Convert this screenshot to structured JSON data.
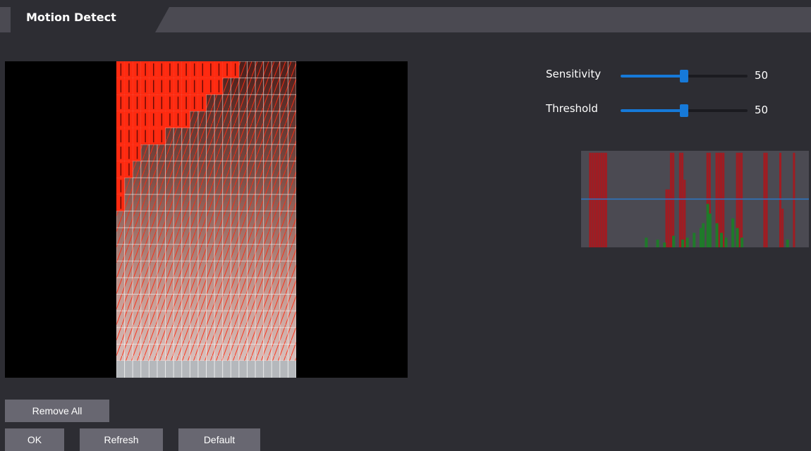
{
  "tab": {
    "title": "Motion Detect"
  },
  "settings": [
    {
      "label": "Sensitivity",
      "value": 50,
      "display": "50"
    },
    {
      "label": "Threshold",
      "value": 50,
      "display": "50"
    }
  ],
  "buttons": {
    "remove_all": "Remove All",
    "ok": "OK",
    "refresh": "Refresh",
    "default": "Default"
  },
  "colors": {
    "accent": "#1679d8",
    "grid_line": "#ff2a10",
    "detected_block": "#ff2a10",
    "graph_bar_red": "#a01c22",
    "graph_bar_green": "#1f7a2a",
    "graph_threshold_line": "#2a78c8",
    "button_bg": "#686771",
    "panel_bg": "#2d2d33"
  },
  "motion_graph": {
    "threshold_line": 0.5,
    "red_bars": [
      0.98,
      0.98,
      0.98,
      0.98,
      0.98,
      0.98,
      0.98,
      0.98,
      0.6,
      0.6,
      0.98,
      0.98,
      0.98,
      0.98,
      0.7,
      0.98,
      0.98,
      0.98,
      0.98,
      0.98,
      0.98,
      0.98,
      0.98,
      0.98,
      0.98,
      0.98,
      0.98,
      0.4,
      0.98
    ],
    "green_bars": [
      0.1,
      0.08,
      0.05,
      0.12,
      0.08,
      0.1,
      0.15,
      0.2,
      0.25,
      0.45,
      0.35,
      0.25,
      0.15,
      0.1,
      0.3,
      0.2,
      0.1,
      0.08
    ]
  }
}
